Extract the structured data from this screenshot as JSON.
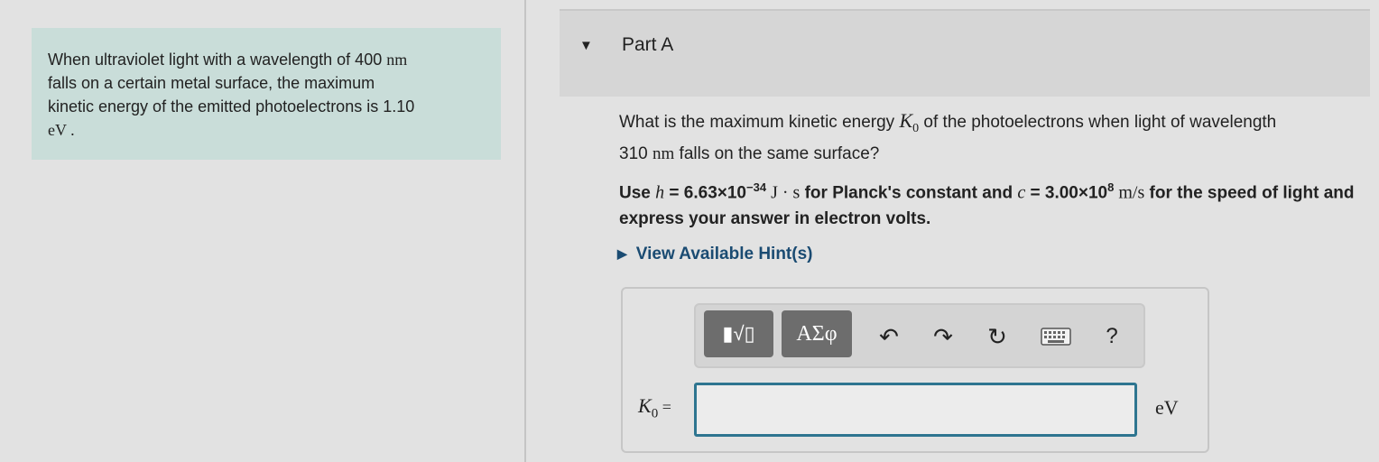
{
  "intro": {
    "line1_a": "When ultraviolet light with a wavelength of 400 ",
    "line1_unit": "nm",
    "line2": "falls on a certain metal surface, the maximum",
    "line3": "kinetic energy of the emitted photoelectrons is 1.10",
    "line4": "eV ."
  },
  "part": {
    "title": "Part A"
  },
  "question": {
    "a": "What is the maximum kinetic energy ",
    "var": "K",
    "sub": "0",
    "b": " of the photoelectrons when light of wavelength",
    "c": "310 ",
    "unit": "nm",
    "d": " falls on the same surface?"
  },
  "instructions": {
    "a": "Use ",
    "h_var": "h",
    "h_val": " = 6.63×10",
    "h_exp": "−34",
    "h_unit": " J · s",
    "b": " for Planck's constant and ",
    "c_var": "c",
    "c_val": " = 3.00×10",
    "c_exp": "8",
    "c_unit": " m/s",
    "d": " for the speed of light and express your answer in electron volts."
  },
  "hint": {
    "label": "View Available Hint(s)"
  },
  "toolbar": {
    "template_label": "▮√▯",
    "symbols_label": "ΑΣφ",
    "undo_icon": "↶",
    "redo_icon": "↷",
    "reset_icon": "↻",
    "keyboard_icon": "keyboard-icon",
    "help_label": "?"
  },
  "answer": {
    "var": "K",
    "sub": "0",
    "eq": " =",
    "value": "",
    "unit": "eV"
  }
}
